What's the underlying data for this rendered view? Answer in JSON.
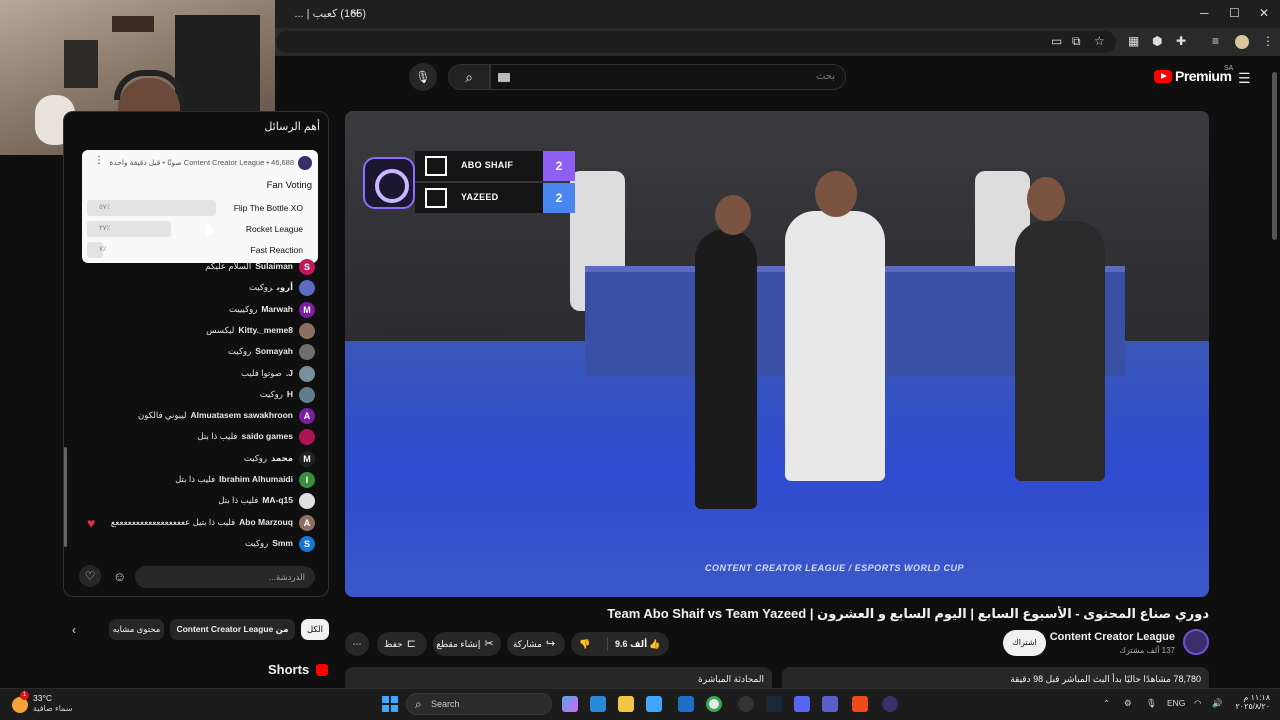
{
  "browser": {
    "tab_title": "(165) كعبب | ...",
    "tab_close": "×",
    "tab_new": "+",
    "win_min": "─",
    "win_max": "☐",
    "win_close": "✕"
  },
  "youtube": {
    "logo_text": "Premium",
    "logo_region": "SA",
    "search_placeholder": "بحث"
  },
  "video": {
    "scoreboard": {
      "team1": "ABO SHAIF",
      "team1_score": "2",
      "team2": "YAZEED",
      "team2_score": "2"
    },
    "footer": "CONTENT CREATOR LEAGUE  /  ESPORTS WORLD CUP",
    "title": "دوري صناع المحتوى - الأسبوع السابع | اليوم السابع و العشرون | Team Abo Shaif vs Team Yazeed",
    "channel_name": "Content Creator League",
    "channel_subs": "137 ألف مشترك",
    "subscribe_label": "اشتراك",
    "like_count": "9.6 ألف",
    "share_label": "مشاركة",
    "clip_label": "إنشاء مقطع",
    "save_label": "حفظ",
    "more_label": "⋯",
    "viewers_text": "78,780 مشاهدًا حاليًا  بدأ البث المباشر قبل 98 دقيقة",
    "live_chat_label": "المحادثة المباشرة"
  },
  "chat": {
    "header": "أهم الرسائل",
    "poll": {
      "meta": "Content Creator League • 46,688 صوتًا • قبل دقيقة واحدة",
      "question": "Fan Voting",
      "options": [
        {
          "label": "Flip The Bottle XO",
          "pct": "٥٧٪",
          "fraction": 0.57
        },
        {
          "label": "Rocket League",
          "pct": "٣٧٪",
          "fraction": 0.37
        },
        {
          "label": "Fast Reaction",
          "pct": "٧٪",
          "fraction": 0.07
        }
      ]
    },
    "messages": [
      {
        "author": "Sulaiman",
        "text": "السلام عليكم",
        "avatar": "S",
        "color": "#c2185b"
      },
      {
        "author": "أروى",
        "text": "روكيت",
        "avatar": "",
        "color": "#5c6bc0"
      },
      {
        "author": "Marwah",
        "text": "روكيييت",
        "avatar": "M",
        "color": "#7b1fa2"
      },
      {
        "author": "Kitty._meme8",
        "text": "ليكسس",
        "avatar": "",
        "color": "#8d6e63"
      },
      {
        "author": "Somayah",
        "text": "روكيت",
        "avatar": "",
        "color": "#6d6d6d"
      },
      {
        "author": "J.",
        "text": "صوتوا فليب",
        "avatar": "",
        "color": "#78909c"
      },
      {
        "author": "H",
        "text": "روكيت",
        "avatar": "",
        "color": "#607d8b"
      },
      {
        "author": "Almuatasem sawakhroon",
        "text": "ليبوني فالكون",
        "avatar": "A",
        "color": "#7b1fa2"
      },
      {
        "author": "saido games",
        "text": "فليب ذا بتل",
        "avatar": "",
        "color": "#ad1457"
      },
      {
        "author": "محمد",
        "text": "روكيت",
        "avatar": "M",
        "color": "#212121"
      },
      {
        "author": "Ibrahim Alhumaidi",
        "text": "فليب ذا بتل",
        "avatar": "I",
        "color": "#388e3c"
      },
      {
        "author": "MA-q15",
        "text": "فليب ذا بتل",
        "avatar": "",
        "color": "#e0e0e0"
      },
      {
        "author": "Abo Marzouq",
        "text": "فليب ذا بتيل ععععععععععععععععععع",
        "avatar": "A",
        "color": "#8d6e63"
      },
      {
        "author": "Smm",
        "text": "روكيت",
        "avatar": "S",
        "color": "#1976d2"
      }
    ],
    "input_placeholder": "الدردشة..."
  },
  "chips": {
    "all": "الكل",
    "from_channel": "من Content Creator League",
    "related": "محتوى مشابه"
  },
  "shorts_label": "Shorts",
  "taskbar": {
    "weather_temp": "33°C",
    "weather_desc": "سماء صافية",
    "weather_badge": "1",
    "search_label": "Search",
    "lang": "ENG",
    "time": "١١:١٨ م",
    "date": "٢٠٢٥/٨/٢٠"
  }
}
